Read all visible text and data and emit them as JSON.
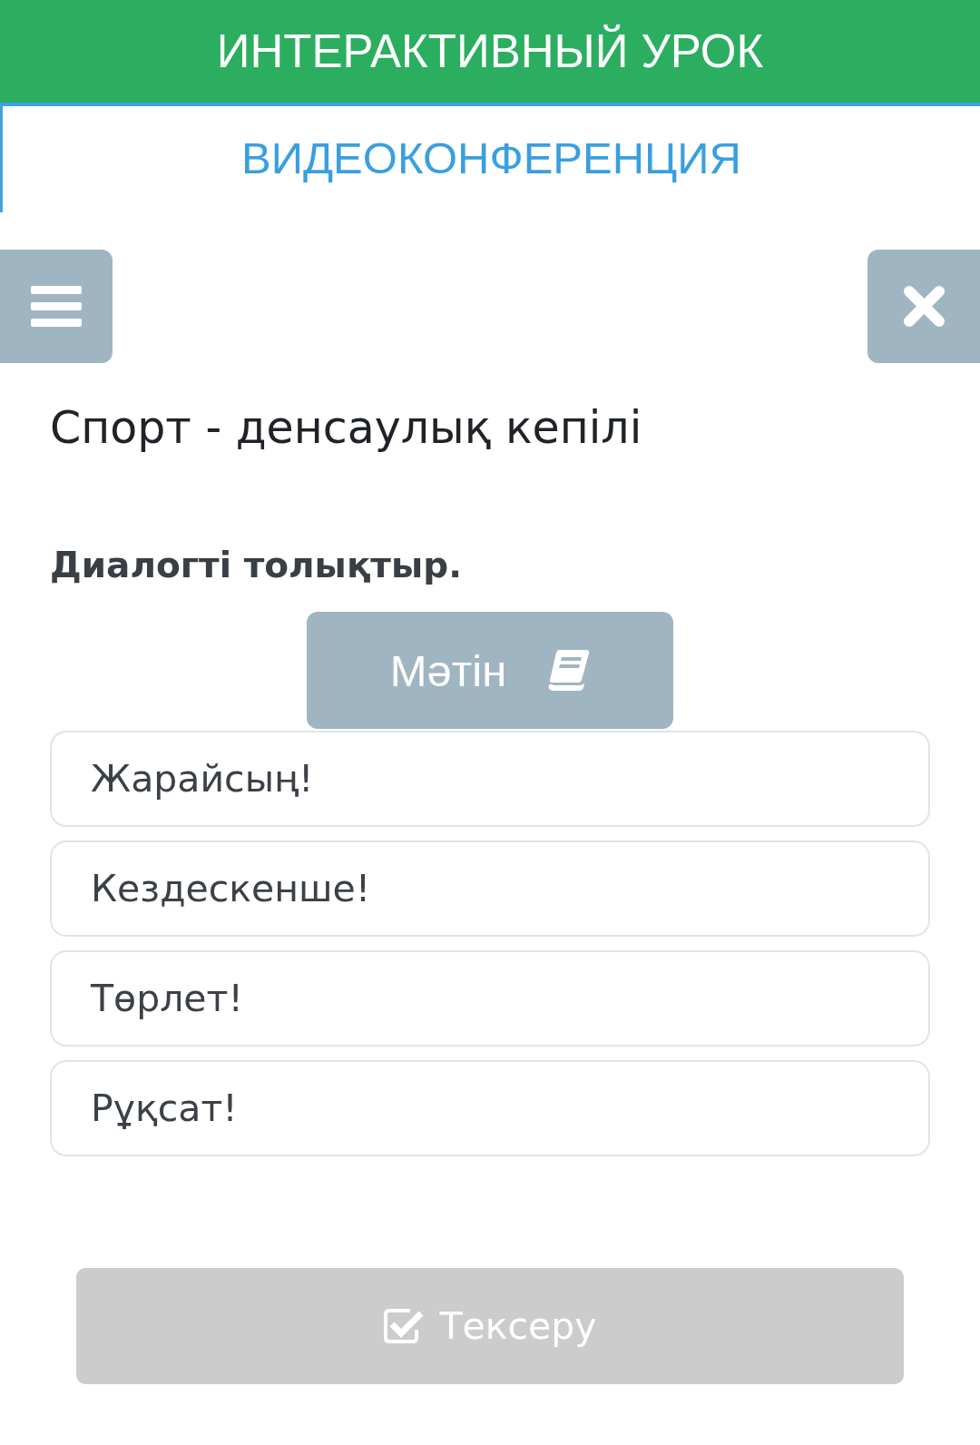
{
  "header": {
    "title": "ИНТЕРАКТИВНЫЙ УРОК",
    "subtitle": "ВИДЕОКОНФЕРЕНЦИЯ"
  },
  "lesson": {
    "title": "Спорт - денсаулық кепілі",
    "instruction": "Диалогті толықтыр.",
    "text_button": "Мәтін",
    "options": [
      "Жарайсың!",
      "Кездескенше!",
      "Төрлет!",
      "Рұқсат!"
    ]
  },
  "check_button": {
    "label": "Тексеру",
    "disabled": true
  }
}
